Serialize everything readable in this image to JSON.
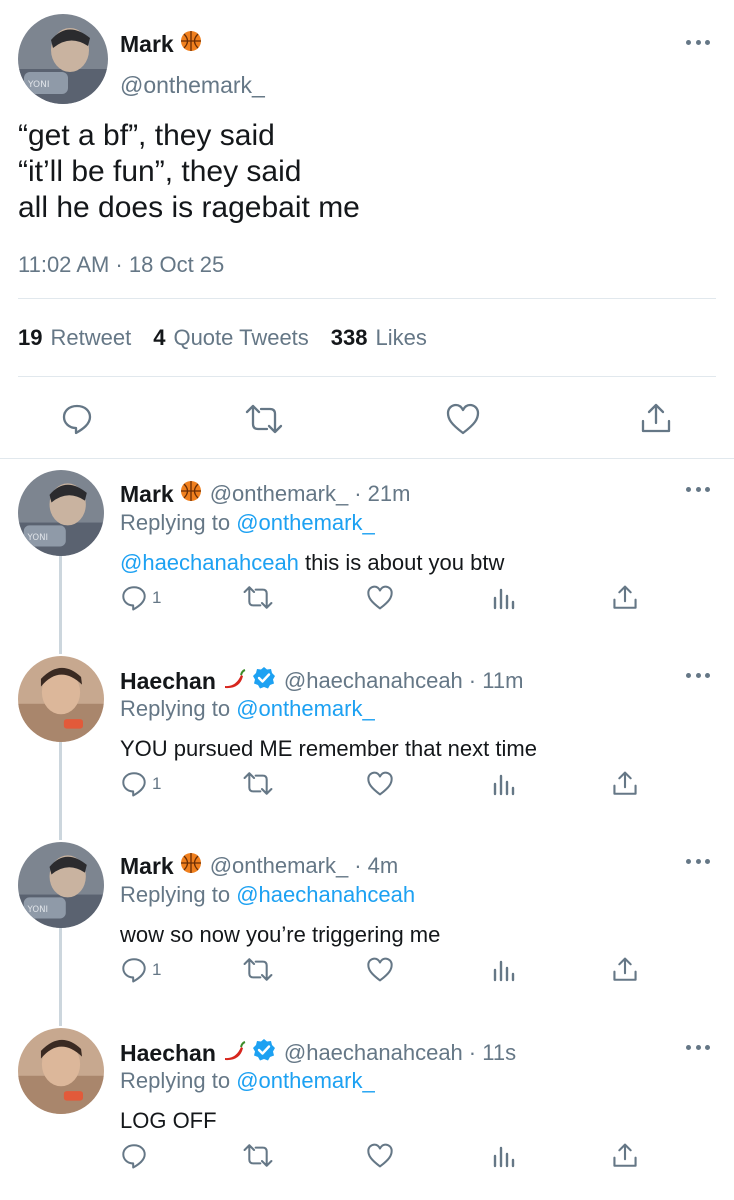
{
  "main_tweet": {
    "author_name": "Mark",
    "author_emoji": "basketball",
    "handle": "@onthemark_",
    "text_lines": [
      "“get a bf”, they said",
      "“it’ll be fun”, they said",
      "all he does is ragebait me"
    ],
    "timestamp": "11:02 AM · 18 Oct 25",
    "stats": [
      {
        "num": "19",
        "label": "Retweet"
      },
      {
        "num": "4",
        "label": "Quote Tweets"
      },
      {
        "num": "338",
        "label": "Likes"
      }
    ]
  },
  "replies": [
    {
      "author_name": "Mark",
      "author_emoji": "basketball",
      "verified": false,
      "handle": "@onthemark_",
      "time": "· 21m",
      "replying_prefix": "Replying to",
      "replying_to": "@onthemark_",
      "mention": "@haechanahceah",
      "text": " this is about you btw",
      "reply_count": "1"
    },
    {
      "author_name": "Haechan",
      "author_emoji": "chili-pepper",
      "verified": true,
      "handle": "@haechanahceah",
      "time": "· 11m",
      "replying_prefix": "Replying to",
      "replying_to": "@onthemark_",
      "mention": "",
      "text": "YOU pursued ME remember that next time",
      "reply_count": "1"
    },
    {
      "author_name": "Mark",
      "author_emoji": "basketball",
      "verified": false,
      "handle": "@onthemark_",
      "time": "· 4m",
      "replying_prefix": "Replying to",
      "replying_to": "@haechanahceah",
      "mention": "",
      "text": "wow so now you’re triggering me",
      "reply_count": "1"
    },
    {
      "author_name": "Haechan",
      "author_emoji": "chili-pepper",
      "verified": true,
      "handle": "@haechanahceah",
      "time": "· 11s",
      "replying_prefix": "Replying to",
      "replying_to": "@onthemark_",
      "mention": "",
      "text": "LOG OFF",
      "reply_count": ""
    }
  ],
  "colors": {
    "link": "#1da1f2",
    "secondary": "#657786",
    "divider": "#e1e8ed",
    "verified": "#1da1f2"
  }
}
